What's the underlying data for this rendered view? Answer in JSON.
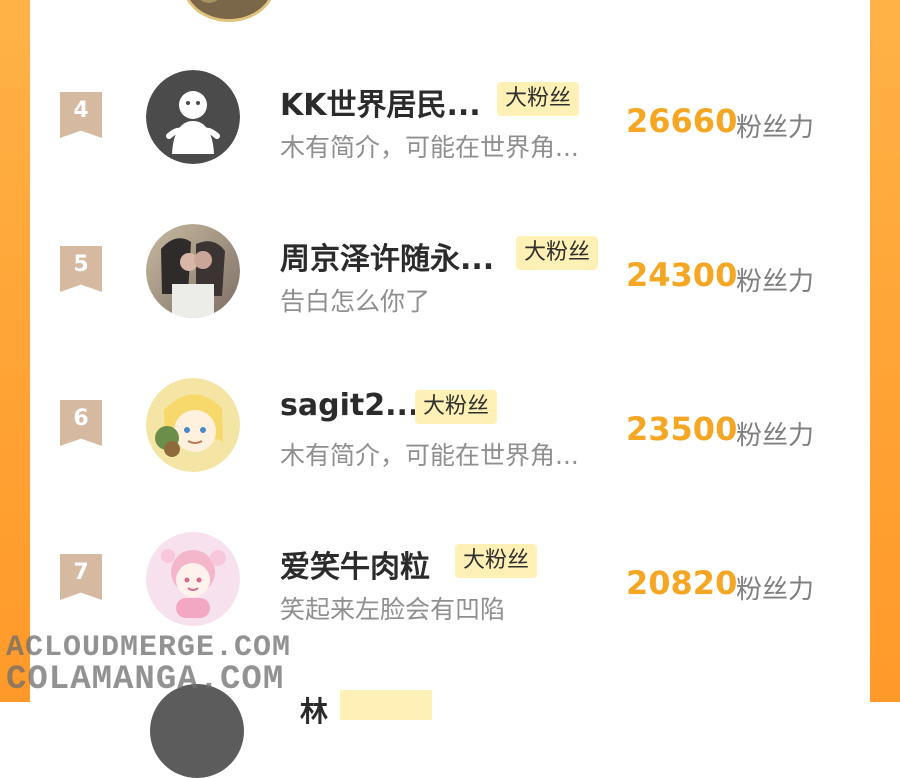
{
  "list_items": [
    {
      "rank": "4",
      "name": "KK世界居民...",
      "tag": "大粉丝",
      "bio": "木有简介，可能在世界角...",
      "score": "26660",
      "score_unit": "粉丝力",
      "avatar_icon": "white-ghost-figure-on-dark-circle"
    },
    {
      "rank": "5",
      "name": "周京泽许随永...",
      "tag": "大粉丝",
      "bio": "告白怎么你了",
      "score": "24300",
      "score_unit": "粉丝力",
      "avatar_icon": "couple-photo-avatar"
    },
    {
      "rank": "6",
      "name": "sagit2...",
      "tag": "大粉丝",
      "bio": "木有简介，可能在世界角...",
      "score": "23500",
      "score_unit": "粉丝力",
      "avatar_icon": "anime-blonde-character-avatar"
    },
    {
      "rank": "7",
      "name": "爱笑牛肉粒",
      "tag": "大粉丝",
      "bio": "笑起来左脸会有凹陷",
      "score": "20820",
      "score_unit": "粉丝力",
      "avatar_icon": "pink-anime-girl-avatar"
    }
  ],
  "partial_next_item": {
    "name_fragment": "林"
  },
  "watermark": {
    "line1": "ACLOUDMERGE.COM",
    "line2": "COLAMANGA.COM"
  },
  "colors": {
    "accent_orange": "#f5a623",
    "tag_bg": "#fff1b6",
    "badge_bg": "#d6b9a1",
    "side_orange": "#ffa436"
  }
}
